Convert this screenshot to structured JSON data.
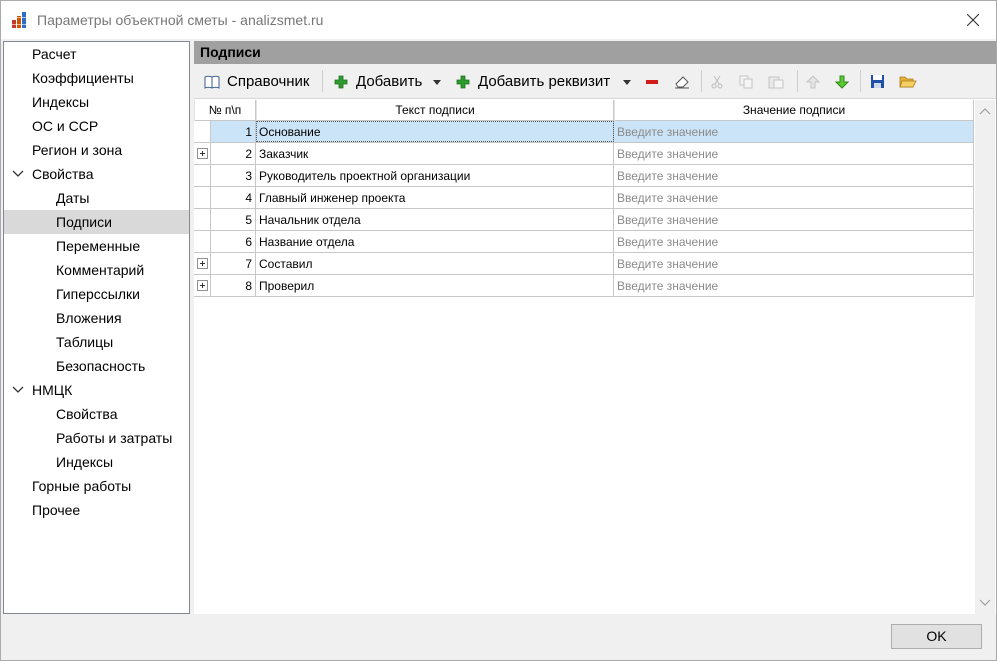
{
  "window": {
    "title": "Параметры объектной сметы - analizsmet.ru"
  },
  "sidebar": {
    "items": [
      {
        "label": "Расчет"
      },
      {
        "label": "Коэффициенты"
      },
      {
        "label": "Индексы"
      },
      {
        "label": "ОС и ССР"
      },
      {
        "label": "Регион и зона"
      },
      {
        "label": "Свойства",
        "expanded": true
      },
      {
        "label": "Даты"
      },
      {
        "label": "Подписи",
        "selected": true
      },
      {
        "label": "Переменные"
      },
      {
        "label": "Комментарий"
      },
      {
        "label": "Гиперссылки"
      },
      {
        "label": "Вложения"
      },
      {
        "label": "Таблицы"
      },
      {
        "label": "Безопасность"
      },
      {
        "label": "НМЦК",
        "expanded": true
      },
      {
        "label": "Свойства"
      },
      {
        "label": "Работы и затраты"
      },
      {
        "label": "Индексы"
      },
      {
        "label": "Горные работы"
      },
      {
        "label": "Прочее"
      }
    ]
  },
  "section": {
    "title": "Подписи"
  },
  "toolbar": {
    "reference_label": "Справочник",
    "add_label": "Добавить",
    "add_requisite_label": "Добавить реквизит",
    "icons": [
      "book-icon",
      "plus-icon",
      "dropdown-arrow-icon",
      "plus-icon",
      "dropdown-arrow-icon",
      "minus-icon",
      "eraser-icon",
      "cut-icon",
      "copy-icon",
      "paste-icon",
      "arrow-up-icon",
      "arrow-down-icon",
      "save-icon",
      "open-folder-icon"
    ],
    "colors": {
      "add_green": "#2e9b2e",
      "remove_red": "#d11a1a",
      "save_blue": "#1f4fa8",
      "folder_yellow": "#e6b23a"
    }
  },
  "grid": {
    "columns": [
      "№ п\\п",
      "Текст подписи",
      "Значение подписи"
    ],
    "rows": [
      {
        "num": "1",
        "text": "Основание",
        "value": "Введите значение",
        "expandable": false,
        "selected": true
      },
      {
        "num": "2",
        "text": "Заказчик",
        "value": "Введите значение",
        "expandable": true
      },
      {
        "num": "3",
        "text": "Руководитель проектной организации",
        "value": "Введите значение",
        "expandable": false
      },
      {
        "num": "4",
        "text": "Главный инженер проекта",
        "value": "Введите значение",
        "expandable": false
      },
      {
        "num": "5",
        "text": "Начальник отдела",
        "value": "Введите значение",
        "expandable": false
      },
      {
        "num": "6",
        "text": "Название отдела",
        "value": "Введите значение",
        "expandable": false
      },
      {
        "num": "7",
        "text": "Составил",
        "value": "Введите значение",
        "expandable": true
      },
      {
        "num": "8",
        "text": "Проверил",
        "value": "Введите значение",
        "expandable": true
      }
    ],
    "selection_color": "#cce4f7"
  },
  "footer": {
    "ok_label": "OK"
  }
}
